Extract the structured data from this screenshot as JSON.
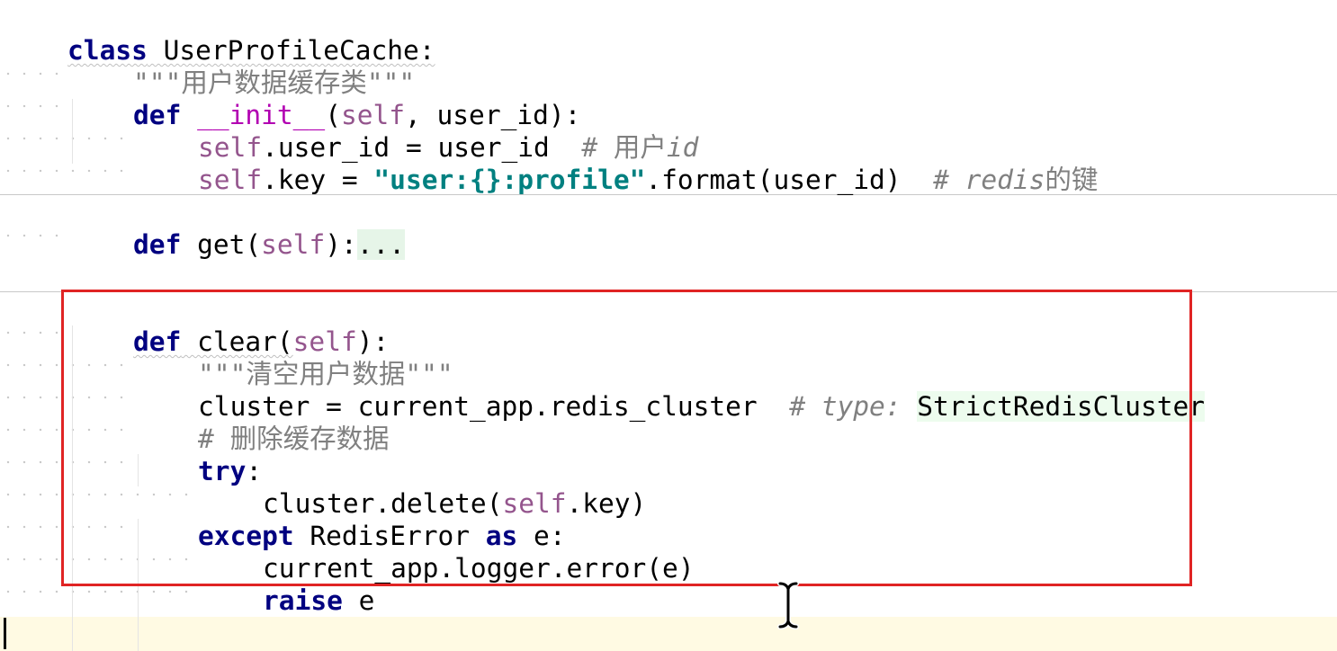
{
  "editor": {
    "language": "python",
    "lines": {
      "l1_kw": "class",
      "l1_name": " UserProfileCache:",
      "l2_doc": "\"\"\"用户数据缓存类\"\"\"",
      "l3_kw": "def",
      "l3_magic": "__init__",
      "l3_open": "(",
      "l3_self": "self",
      "l3_rest": ", user_id):",
      "l4_self": "self",
      "l4_code": ".user_id = user_id  ",
      "l4_hash": "# 用户",
      "l4_italic": "id",
      "l5_self": "self",
      "l5_code": ".key = ",
      "l5_str": "\"user:{}:profile\"",
      "l5_code2": ".format(user_id)  ",
      "l5_hash": "# ",
      "l5_italic": "redis",
      "l5_cjk": "的键",
      "l6_kw": "def",
      "l6_code": " get(",
      "l6_self": "self",
      "l6_close": "):",
      "l6_fold": "...",
      "l7_kw": "def",
      "l7_code": " clear(",
      "l7_self": "self",
      "l7_close": "):",
      "l8_doc": "\"\"\"清空用户数据\"\"\"",
      "l9_code": "cluster = current_app.redis_cluster  ",
      "l9_hash": "# ",
      "l9_type": "type: ",
      "l9_typename": "StrictRedisCluster",
      "l10_cmt": "# 删除缓存数据",
      "l11_kw": "try",
      "l11_colon": ":",
      "l12_code": "cluster.delete(",
      "l12_self": "self",
      "l12_close": ".key)",
      "l13_kw": "except",
      "l13_code": " RedisError ",
      "l13_kw2": "as",
      "l13_code2": " e:",
      "l14_code": "current_app.logger.error(e)",
      "l15_kw": "raise",
      "l15_code": " e"
    },
    "colors": {
      "keyword": "#000080",
      "self": "#94558d",
      "magic_method": "#b200b2",
      "string": "#008080",
      "comment": "#808080",
      "highlight_box": "#e02424",
      "current_line": "#fffae3"
    },
    "icons": {
      "cursor": "text-ibeam-cursor-icon"
    }
  }
}
